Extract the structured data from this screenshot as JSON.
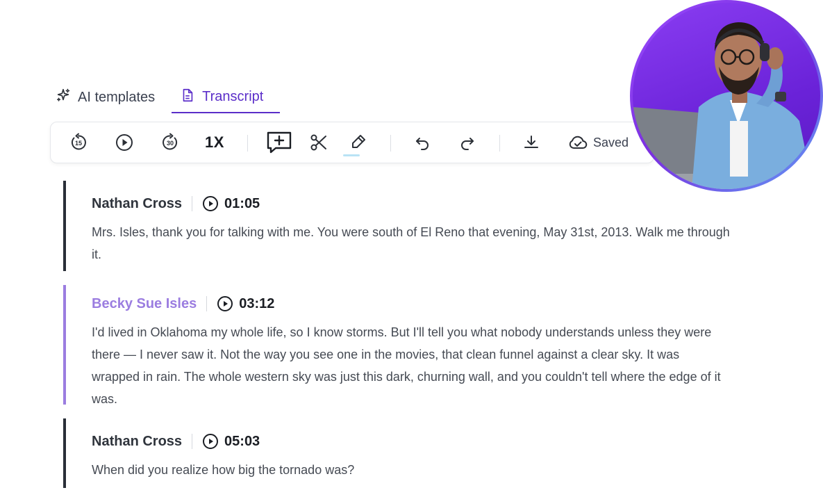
{
  "tabs": [
    {
      "label": "AI templates",
      "icon": "sparkle-icon",
      "active": false
    },
    {
      "label": "Transcript",
      "icon": "document-icon",
      "active": true
    }
  ],
  "toolbar": {
    "rewind_label": "15",
    "forward_label": "30",
    "speed": "1X",
    "saved_label": "Saved"
  },
  "transcript": [
    {
      "speaker": "Nathan Cross",
      "time": "01:05",
      "text": "Mrs. Isles, thank you for talking with me. You were south of El Reno that evening, May 31st, 2013. Walk me through it."
    },
    {
      "speaker": "Becky Sue Isles",
      "time": "03:12",
      "text": "I'd lived in Oklahoma my whole life, so I know storms. But I'll tell you what nobody understands unless they were there — I never saw it. Not the way you see one in the movies, that clean funnel against a clear sky. It was wrapped in rain. The whole western sky was just this dark, churning wall, and you couldn't tell where the edge of it was."
    },
    {
      "speaker": "Nathan Cross",
      "time": "05:03",
      "text": "When did you realize how big the tornado was?"
    }
  ],
  "colors": {
    "accent": "#5b2ec9",
    "highlight_speaker": "#9b7de0"
  }
}
